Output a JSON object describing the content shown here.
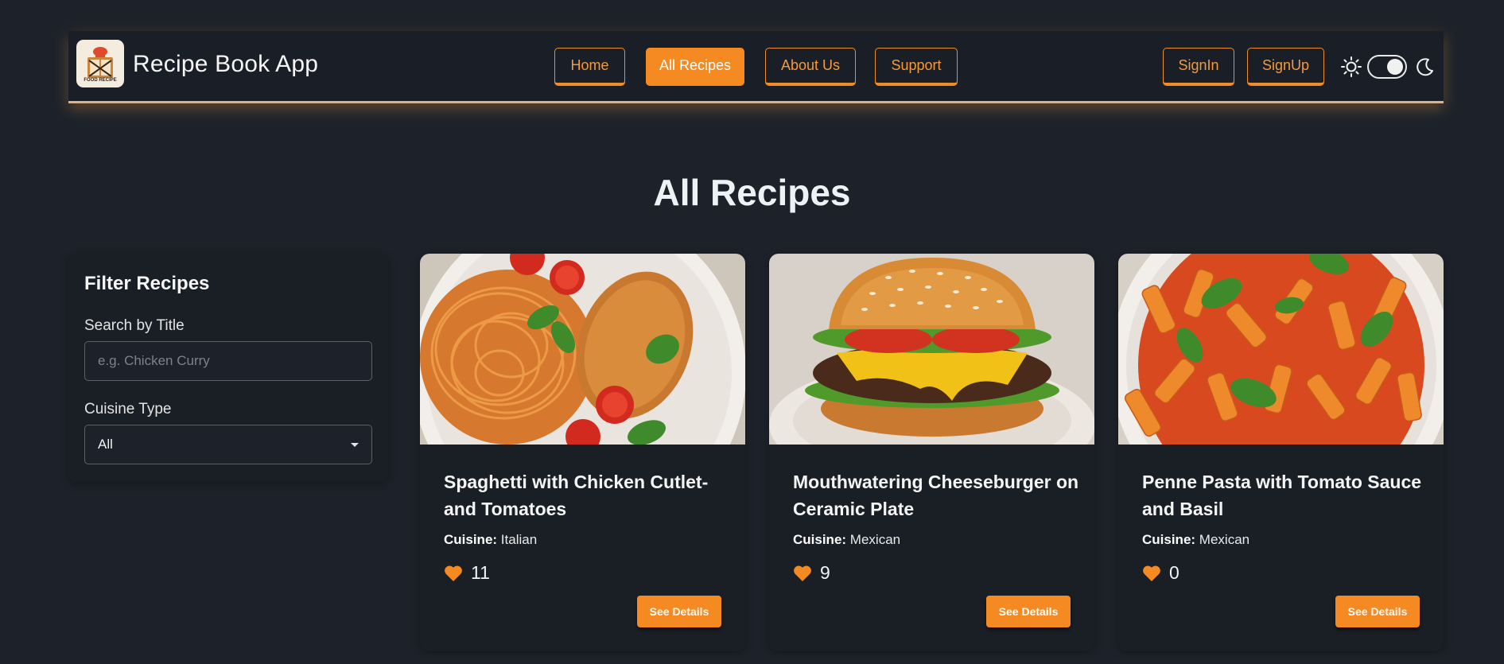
{
  "brand": {
    "logo_text": "FOOD RECIPE",
    "name": "Recipe Book App"
  },
  "nav": {
    "home": "Home",
    "all_recipes": "All Recipes",
    "about": "About Us",
    "support": "Support",
    "signin": "SignIn",
    "signup": "SignUp",
    "active": "All Recipes",
    "theme_toggle_on": true
  },
  "colors": {
    "accent": "#f58a23",
    "background": "#1d222a",
    "panel": "#1a1f26"
  },
  "page": {
    "title": "All Recipes"
  },
  "filter": {
    "title": "Filter Recipes",
    "search_label": "Search by Title",
    "search_placeholder": "e.g. Chicken Curry",
    "search_value": "",
    "cuisine_label": "Cuisine Type",
    "cuisine_selected": "All"
  },
  "recipes": [
    {
      "title": "Spaghetti with Chicken Cutlet-and Tomatoes",
      "cuisine_label": "Cuisine:",
      "cuisine": "Italian",
      "likes": "11",
      "button": "See Details",
      "image": "spaghetti-chicken-cutlet-photo"
    },
    {
      "title": "Mouthwatering Cheeseburger on Ceramic Plate",
      "cuisine_label": "Cuisine:",
      "cuisine": "Mexican",
      "likes": "9",
      "button": "See Details",
      "image": "cheeseburger-photo"
    },
    {
      "title": "Penne Pasta with Tomato Sauce and Basil",
      "cuisine_label": "Cuisine:",
      "cuisine": "Mexican",
      "likes": "0",
      "button": "See Details",
      "image": "penne-pasta-photo"
    }
  ],
  "icons": {
    "sun": "sun-icon",
    "moon": "moon-icon",
    "heart": "heart-icon",
    "caret": "caret-down-icon"
  }
}
